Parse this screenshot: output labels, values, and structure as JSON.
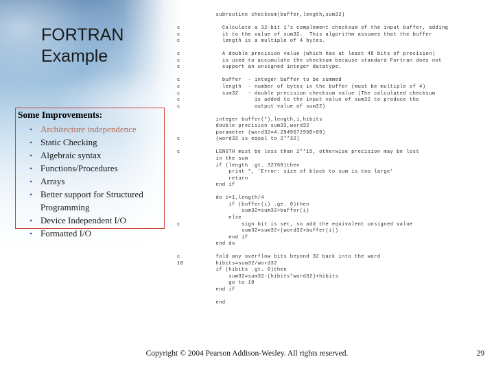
{
  "slide": {
    "title": "FORTRAN\nExample",
    "bullet_box": {
      "heading": "Some Improvements:",
      "bullet_glyph": "•",
      "items": [
        "Architecture independence",
        "Static Checking",
        "Algebraic syntax",
        "Functions/Procedures",
        "Arrays",
        "Better support for Structured Programming",
        "Device Independent I/O",
        "Formatted I/O"
      ]
    },
    "code": "            subroutine checksum(buffer,length,sum32)\n\nc             Calculate a 32-bit 1's complement checksum of the input buffer, adding\nc             it to the value of sum32.  This algorithm assumes that the buffer\nc             length is a multiple of 4 bytes.\n\nc             A double precision value (which has at least 48 bits of precision)\nc             is used to accumulate the checksum because standard Fortran does not\nc             support an unsigned integer datatype.\n\nc             buffer  - integer buffer to be summed\nc             length  - number of bytes in the buffer (must be multiple of 4)\nc             sum32   - double precision checksum value (The calculated checksum\nc                       is added to the input value of sum32 to produce the\nc                       output value of sum32)\n\n            integer buffer(*),length,i,hibits\n            double precision sum32,word32\n            parameter (word32=4.294967296D+09)\nc           (word32 is equal to 2**32)\n\nc           LENGTH must be less than 2**15, otherwise precision may be lost\n            in the sum\n            if (length .gt. 32768)then\n                print *, 'Error: size of block to sum is too large'\n                return\n            end if\n\n            do i=1,length/4\n                if (buffer(i) .ge. 0)then\n                    sum32=sum32+buffer(i)\n                else\nc                   sign bit is set, so add the equivalent unsigned value\n                    sum32=sum32+(word32+buffer(i))\n                end if\n            end do\n\nc           fold any overflow bits beyond 32 back into the word\n10          hibits=sum32/word32\n            if (hibits .gt. 0)then\n                sum32=sum32-(hibits*word32)+hibits\n                go to 10\n            end if\n\n            end"
  },
  "footer": {
    "copyright": "Copyright © 2004 Pearson Addison-Wesley. All rights reserved.",
    "page_number": "29"
  }
}
